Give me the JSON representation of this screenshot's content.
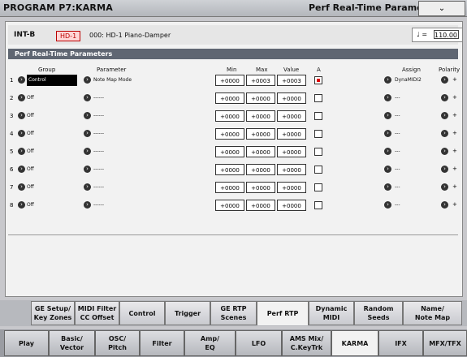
{
  "title": "PROGRAM P7:KARMA",
  "page_name": "Perf Real-Time Parameters",
  "menu_symbol": "⌄",
  "program": {
    "bank_id": "INT-B",
    "badge": "HD-1",
    "name": "000: HD-1 Piano-Damper"
  },
  "tempo": {
    "symbol": "♩ =",
    "value": "110.00"
  },
  "section_title": "Perf Real-Time Parameters",
  "columns": {
    "group": "Group",
    "parameter": "Parameter",
    "min": "Min",
    "max": "Max",
    "value": "Value",
    "a": "A",
    "assign": "Assign",
    "polarity": "Polarity"
  },
  "rows": [
    {
      "num": "1",
      "group": "Control",
      "parameter": "Note Map Mode",
      "min": "+0000",
      "max": "+0003",
      "value": "+0003",
      "checked": true,
      "assign": "DynaMIDI2",
      "polarity": "+"
    },
    {
      "num": "2",
      "group": "Off",
      "parameter": "------",
      "min": "+0000",
      "max": "+0000",
      "value": "+0000",
      "checked": false,
      "assign": "---",
      "polarity": "+"
    },
    {
      "num": "3",
      "group": "Off",
      "parameter": "------",
      "min": "+0000",
      "max": "+0000",
      "value": "+0000",
      "checked": false,
      "assign": "---",
      "polarity": "+"
    },
    {
      "num": "4",
      "group": "Off",
      "parameter": "------",
      "min": "+0000",
      "max": "+0000",
      "value": "+0000",
      "checked": false,
      "assign": "---",
      "polarity": "+"
    },
    {
      "num": "5",
      "group": "Off",
      "parameter": "------",
      "min": "+0000",
      "max": "+0000",
      "value": "+0000",
      "checked": false,
      "assign": "---",
      "polarity": "+"
    },
    {
      "num": "6",
      "group": "Off",
      "parameter": "------",
      "min": "+0000",
      "max": "+0000",
      "value": "+0000",
      "checked": false,
      "assign": "---",
      "polarity": "+"
    },
    {
      "num": "7",
      "group": "Off",
      "parameter": "------",
      "min": "+0000",
      "max": "+0000",
      "value": "+0000",
      "checked": false,
      "assign": "---",
      "polarity": "+"
    },
    {
      "num": "8",
      "group": "Off",
      "parameter": "------",
      "min": "+0000",
      "max": "+0000",
      "value": "+0000",
      "checked": false,
      "assign": "---",
      "polarity": "+"
    }
  ],
  "sub_tabs": [
    "GE Setup/\nKey Zones",
    "MIDI Filter\nCC Offset",
    "Control",
    "Trigger",
    "GE RTP\nScenes",
    "Perf RTP",
    "Dynamic\nMIDI",
    "Random\nSeeds",
    "Name/\nNote Map"
  ],
  "sub_tab_active": "Perf RTP",
  "main_tabs": [
    "Play",
    "Basic/\nVector",
    "OSC/\nPitch",
    "Filter",
    "Amp/\nEQ",
    "LFO",
    "AMS Mix/\nC.KeyTrk",
    "KARMA",
    "IFX",
    "MFX/TFX"
  ],
  "main_tab_active": "KARMA",
  "colors": {
    "titlebar": "#c4c7cc",
    "section_header": "#5f6672",
    "checked_red": "#dd0000"
  }
}
